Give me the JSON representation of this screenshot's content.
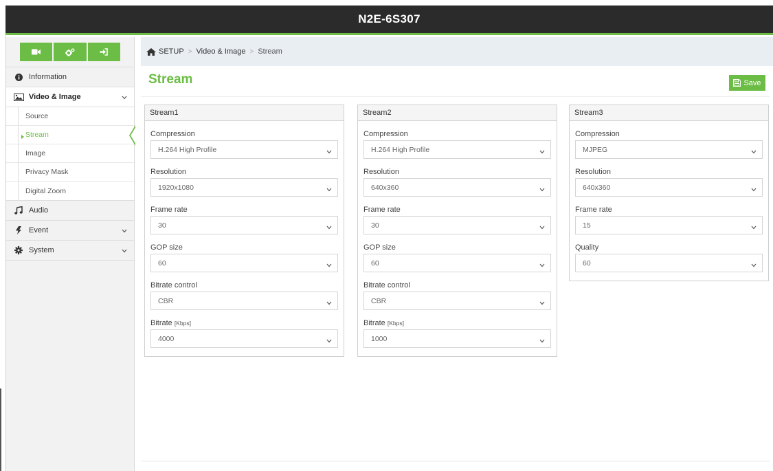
{
  "header": {
    "device_name": "N2E-6S307"
  },
  "toolbar": {
    "buttons": [
      {
        "icon": "video-camera-icon"
      },
      {
        "icon": "gears-icon"
      },
      {
        "icon": "logout-icon"
      }
    ]
  },
  "sidebar": {
    "items": [
      {
        "label": "Information",
        "icon": "info-icon"
      },
      {
        "label": "Video & Image",
        "icon": "image-icon",
        "expanded": true,
        "children": [
          "Source",
          "Stream",
          "Image",
          "Privacy Mask",
          "Digital Zoom"
        ],
        "active_child": "Stream"
      },
      {
        "label": "Audio",
        "icon": "music-icon"
      },
      {
        "label": "Event",
        "icon": "bolt-icon",
        "has_children": true
      },
      {
        "label": "System",
        "icon": "gear-icon",
        "has_children": true
      }
    ]
  },
  "breadcrumb": {
    "root": "SETUP",
    "middle": "Video & Image",
    "current": "Stream"
  },
  "page": {
    "title": "Stream",
    "save_label": "Save"
  },
  "streams": [
    {
      "title": "Stream1",
      "fields": [
        {
          "label": "Compression",
          "value": "H.264 High Profile"
        },
        {
          "label": "Resolution",
          "value": "1920x1080"
        },
        {
          "label": "Frame rate",
          "value": "30"
        },
        {
          "label": "GOP size",
          "value": "60"
        },
        {
          "label": "Bitrate control",
          "value": "CBR"
        },
        {
          "label": "Bitrate",
          "unit": "[Kbps]",
          "value": "4000"
        }
      ]
    },
    {
      "title": "Stream2",
      "fields": [
        {
          "label": "Compression",
          "value": "H.264 High Profile"
        },
        {
          "label": "Resolution",
          "value": "640x360"
        },
        {
          "label": "Frame rate",
          "value": "30"
        },
        {
          "label": "GOP size",
          "value": "60"
        },
        {
          "label": "Bitrate control",
          "value": "CBR"
        },
        {
          "label": "Bitrate",
          "unit": "[Kbps]",
          "value": "1000"
        }
      ]
    },
    {
      "title": "Stream3",
      "fields": [
        {
          "label": "Compression",
          "value": "MJPEG"
        },
        {
          "label": "Resolution",
          "value": "640x360"
        },
        {
          "label": "Frame rate",
          "value": "15"
        },
        {
          "label": "Quality",
          "value": "60"
        }
      ]
    }
  ],
  "colors": {
    "accent": "#6cbd45",
    "topbar": "#2b2b2b",
    "breadcrumb_bg": "#e8eef2",
    "sidebar_bg": "#f2f2f2"
  }
}
